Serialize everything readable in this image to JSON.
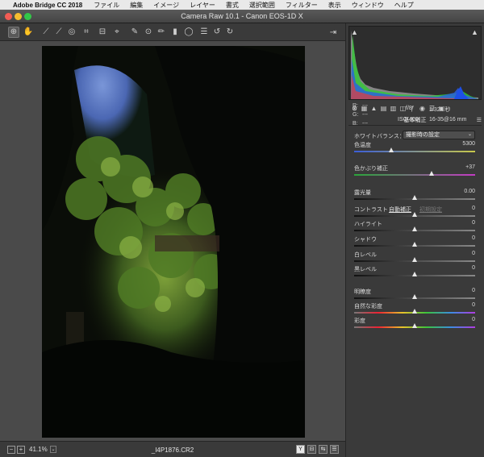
{
  "menubar": {
    "app_name": "Adobe Bridge CC 2018",
    "items": [
      "ファイル",
      "編集",
      "イメージ",
      "レイヤー",
      "書式",
      "選択範囲",
      "フィルター",
      "表示",
      "ウィンドウ",
      "ヘルプ"
    ]
  },
  "window": {
    "title": "Camera Raw 10.1  -  Canon EOS-1D X"
  },
  "toolbar": {
    "tools": [
      {
        "name": "zoom-tool-icon",
        "glyph": "⊕"
      },
      {
        "name": "hand-tool-icon",
        "glyph": "✋"
      },
      {
        "name": "white-balance-tool-icon",
        "glyph": "⟋"
      },
      {
        "name": "color-sampler-icon",
        "glyph": "⟋"
      },
      {
        "name": "target-adjustment-icon",
        "glyph": "◎"
      },
      {
        "name": "crop-tool-icon",
        "glyph": "⌗"
      },
      {
        "name": "straighten-tool-icon",
        "glyph": "⊟"
      },
      {
        "name": "transform-tool-icon",
        "glyph": "⌖"
      },
      {
        "name": "spot-removal-icon",
        "glyph": "✎"
      },
      {
        "name": "red-eye-icon",
        "glyph": "⊙"
      },
      {
        "name": "adjustment-brush-icon",
        "glyph": "✏"
      },
      {
        "name": "graduated-filter-icon",
        "glyph": "▮"
      },
      {
        "name": "radial-filter-icon",
        "glyph": "◯"
      },
      {
        "name": "preferences-icon",
        "glyph": "☰"
      },
      {
        "name": "rotate-left-icon",
        "glyph": "↺"
      },
      {
        "name": "rotate-right-icon",
        "glyph": "↻"
      }
    ],
    "export_glyph": "⇥"
  },
  "status": {
    "zoom": "41.1%",
    "filename": "_I4P1876.CR2",
    "view_mode": "Y"
  },
  "histogram": {
    "info_rgb": [
      "R:",
      "G:",
      "B:"
    ],
    "rgb_values": [
      "---",
      "---",
      "---"
    ],
    "aperture": "f/8",
    "shutter": "1/320 秒",
    "iso": "ISO 400",
    "lens": "16-35@16 mm"
  },
  "panel": {
    "section_title": "基本補正",
    "wb_label": "ホワイトバランス：",
    "wb_value": "撮影時の設定",
    "auto_label": "自動補正",
    "default_label": "初期設定",
    "sliders": [
      {
        "label": "色温度",
        "value": "5300",
        "pos": 0.31,
        "track": "temp"
      },
      {
        "label": "色かぶり補正",
        "value": "+37",
        "pos": 0.64,
        "track": "tint"
      },
      {
        "label": "露光量",
        "value": "0.00",
        "pos": 0.5,
        "track": "gray"
      },
      {
        "label": "コントラスト",
        "value": "0",
        "pos": 0.5,
        "track": "gray"
      },
      {
        "label": "ハイライト",
        "value": "0",
        "pos": 0.5,
        "track": "gray"
      },
      {
        "label": "シャドウ",
        "value": "0",
        "pos": 0.5,
        "track": "gray"
      },
      {
        "label": "白レベル",
        "value": "0",
        "pos": 0.5,
        "track": "gray"
      },
      {
        "label": "黒レベル",
        "value": "0",
        "pos": 0.5,
        "track": "gray"
      },
      {
        "label": "明瞭度",
        "value": "0",
        "pos": 0.5,
        "track": "gray"
      },
      {
        "label": "自然な彩度",
        "value": "0",
        "pos": 0.5,
        "track": "sat"
      },
      {
        "label": "彩度",
        "value": "0",
        "pos": 0.5,
        "track": "sat"
      }
    ]
  }
}
